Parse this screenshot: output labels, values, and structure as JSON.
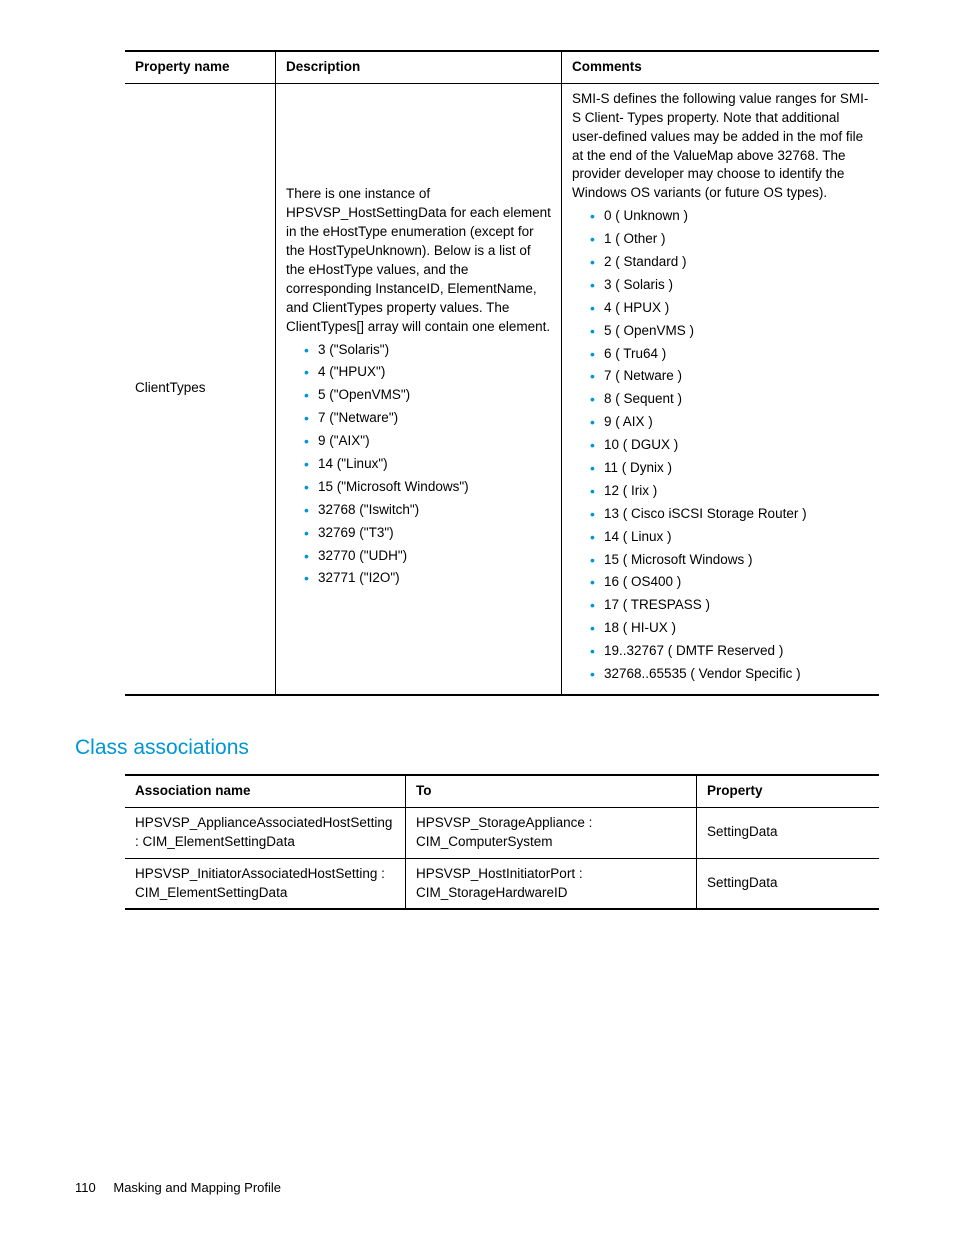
{
  "table1": {
    "headers": [
      "Property name",
      "Description",
      "Comments"
    ],
    "row": {
      "property_name": "ClientTypes",
      "desc_para": "There is one instance of HPSVSP_HostSettingData for each element in the eHostType enumeration (except for the HostTypeUnknown). Below is a list of the eHostType values, and the corresponding InstanceID, ElementName, and ClientTypes property values. The ClientTypes[] array will contain one element.",
      "desc_items": [
        "3 (\"Solaris\")",
        "4 (\"HPUX\")",
        "5 (\"OpenVMS\")",
        "7 (\"Netware\")",
        "9 (\"AIX\")",
        "14 (\"Linux\")",
        "15 (\"Microsoft Windows\")",
        "32768 (\"Iswitch\")",
        "32769 (\"T3\")",
        "32770 (\"UDH\")",
        "32771 (\"I2O\")"
      ],
      "comments_para": "SMI-S defines the following value ranges for SMI-S Client- Types property. Note that additional user-defined values may be added in the mof file at the end of the ValueMap above 32768. The provider developer may choose to identify the Windows OS variants (or future OS types).",
      "comments_items": [
        "0 ( Unknown )",
        "1 ( Other )",
        "2 ( Standard )",
        "3 ( Solaris )",
        "4 ( HPUX )",
        "5 ( OpenVMS )",
        "6 ( Tru64 )",
        "7 ( Netware )",
        "8 ( Sequent )",
        "9 ( AIX )",
        "10 ( DGUX )",
        "11 ( Dynix )",
        "12 ( Irix )",
        "13 ( Cisco iSCSI Storage Router )",
        "14 ( Linux )",
        "15 ( Microsoft Windows )",
        "16 ( OS400 )",
        "17 ( TRESPASS )",
        "18 ( HI-UX )",
        "19..32767 ( DMTF Reserved )",
        "32768..65535 ( Vendor Specific )"
      ]
    }
  },
  "section_heading": "Class associations",
  "table2": {
    "headers": [
      "Association name",
      "To",
      "Property"
    ],
    "rows": [
      {
        "assoc": "HPSVSP_ApplianceAssociatedHostSetting : CIM_ElementSettingData",
        "to": "HPSVSP_StorageAppliance : CIM_ComputerSystem",
        "prop": "SettingData"
      },
      {
        "assoc": "HPSVSP_InitiatorAssociatedHostSetting : CIM_ElementSettingData",
        "to": "HPSVSP_HostInitiatorPort : CIM_StorageHardwareID",
        "prop": "SettingData"
      }
    ]
  },
  "footer": {
    "page_number": "110",
    "title": "Masking and Mapping Profile"
  }
}
